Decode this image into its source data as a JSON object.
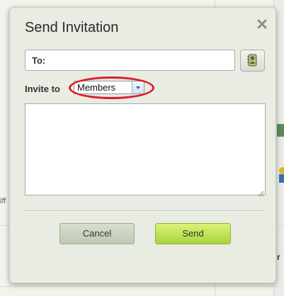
{
  "background": {
    "snippet_left": "iff",
    "snippet_right_letter": "r"
  },
  "dialog": {
    "title": "Send Invitation",
    "close_icon": "close-x-icon",
    "to_label": "To:",
    "to_value": "",
    "contacts_icon": "address-book-icon",
    "invite_label": "Invite to",
    "invite_selected": "Members",
    "message_value": "",
    "cancel_label": "Cancel",
    "send_label": "Send"
  },
  "colors": {
    "highlight": "#e01a2a",
    "send_button": "#b8de4a",
    "cancel_button": "#c9d2bd"
  }
}
